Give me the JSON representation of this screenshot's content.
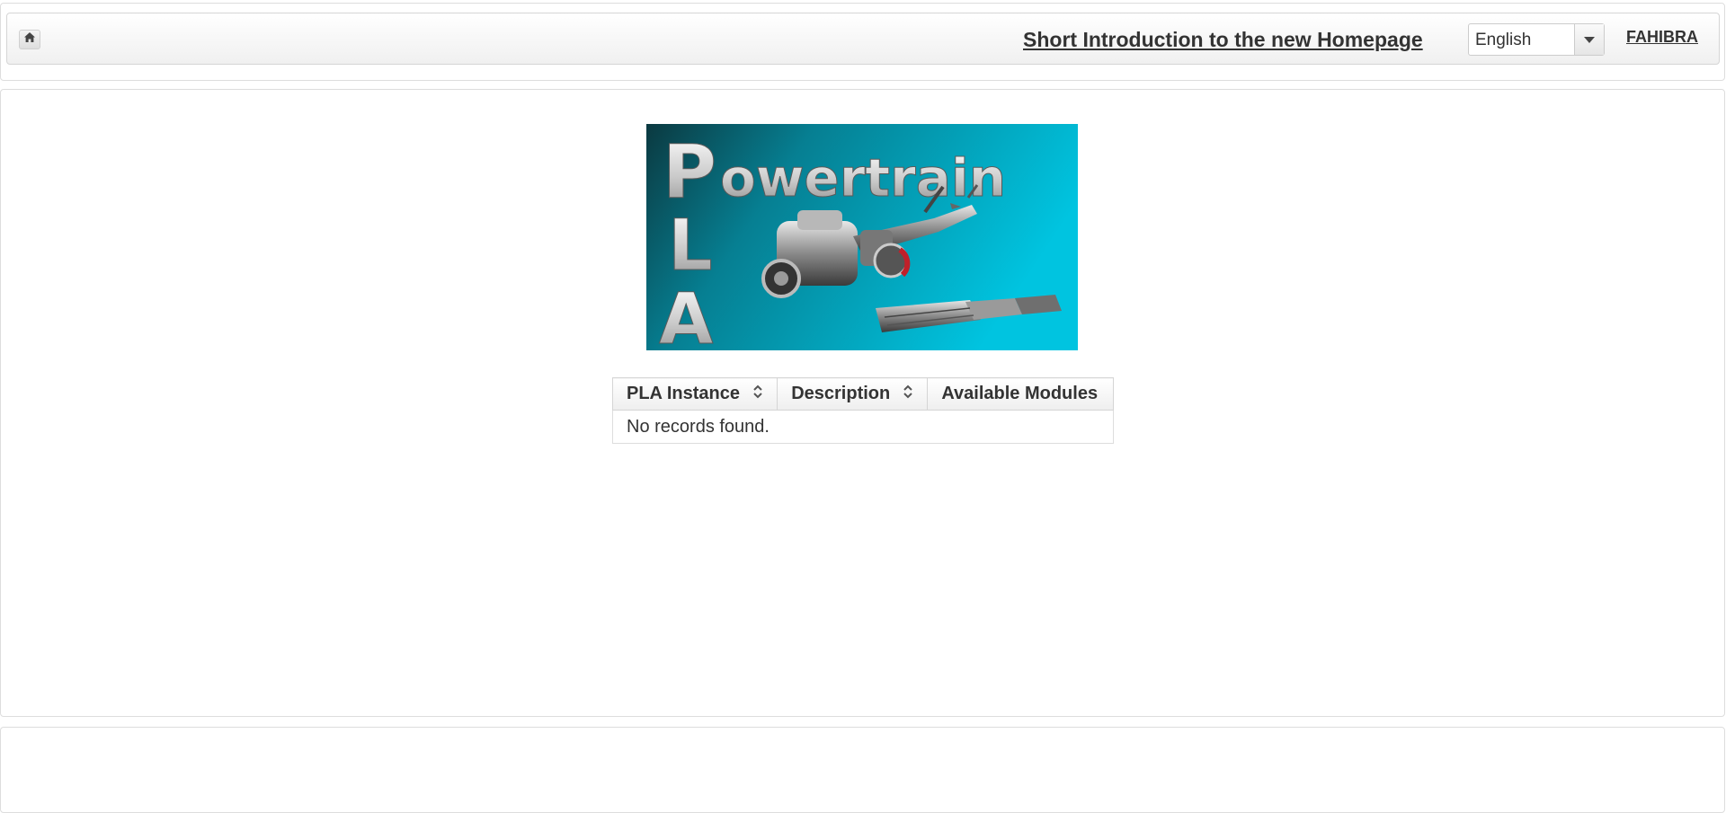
{
  "header": {
    "home_icon": "home-icon",
    "intro_link": "Short Introduction to the new Homepage",
    "language": {
      "selected": "English",
      "icon": "chevron-down-icon"
    },
    "user": "FAHIBRA"
  },
  "logo": {
    "letters": [
      "P",
      "owertrain",
      "L",
      "A"
    ],
    "colors": {
      "dark": "#0b3940",
      "light": "#00c4e0"
    }
  },
  "table": {
    "columns": [
      {
        "label": "PLA Instance",
        "sortable": true
      },
      {
        "label": "Description",
        "sortable": true
      },
      {
        "label": "Available Modules",
        "sortable": false
      }
    ],
    "empty_message": "No records found."
  }
}
